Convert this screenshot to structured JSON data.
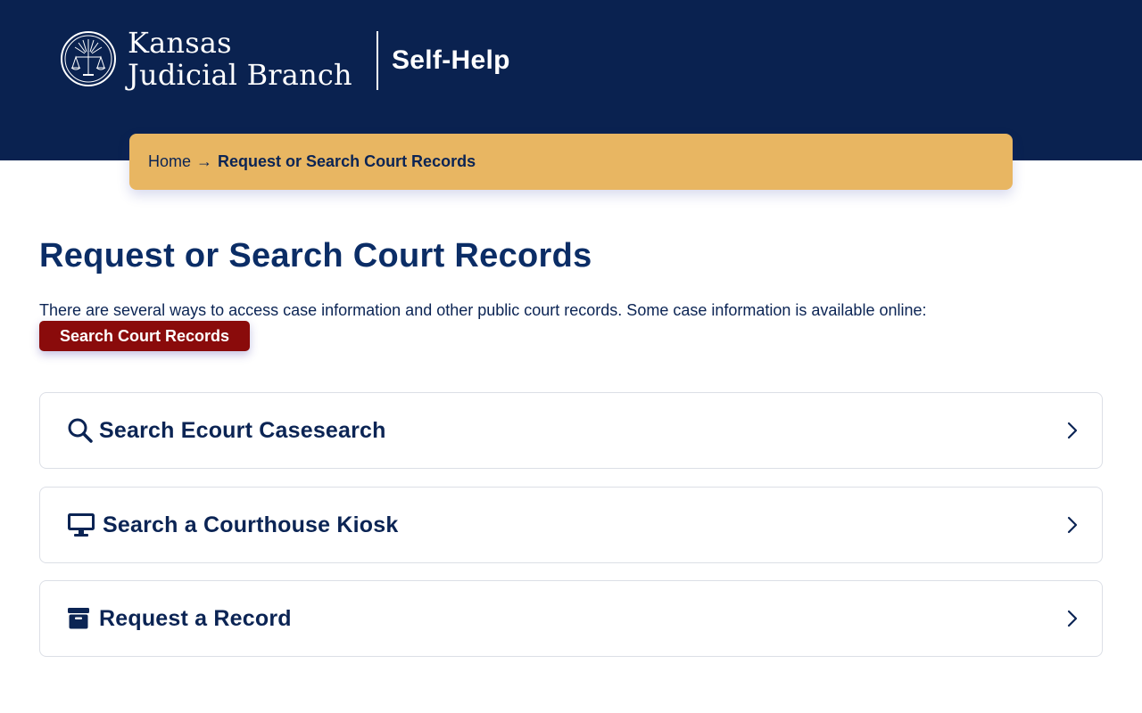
{
  "header": {
    "brand_line1": "Kansas",
    "brand_line2": "Judicial Branch",
    "section": "Self-Help",
    "colors": {
      "background": "#0a2250",
      "text": "#ffffff"
    }
  },
  "breadcrumb": {
    "home": "Home",
    "separator": "→",
    "current": "Request or Search Court Records",
    "background": "#e8b662"
  },
  "main": {
    "title": "Request or Search Court Records",
    "intro": "There are several ways to access case information and other public court records. Some case information is available online:",
    "primary_button": {
      "label": "Search Court Records",
      "color": "#8a0b0b"
    },
    "cards": [
      {
        "label": "Search Ecourt Casesearch",
        "icon": "search-icon"
      },
      {
        "label": "Search a Courthouse Kiosk",
        "icon": "monitor-icon"
      },
      {
        "label": "Request a Record",
        "icon": "archive-box-icon"
      }
    ]
  }
}
